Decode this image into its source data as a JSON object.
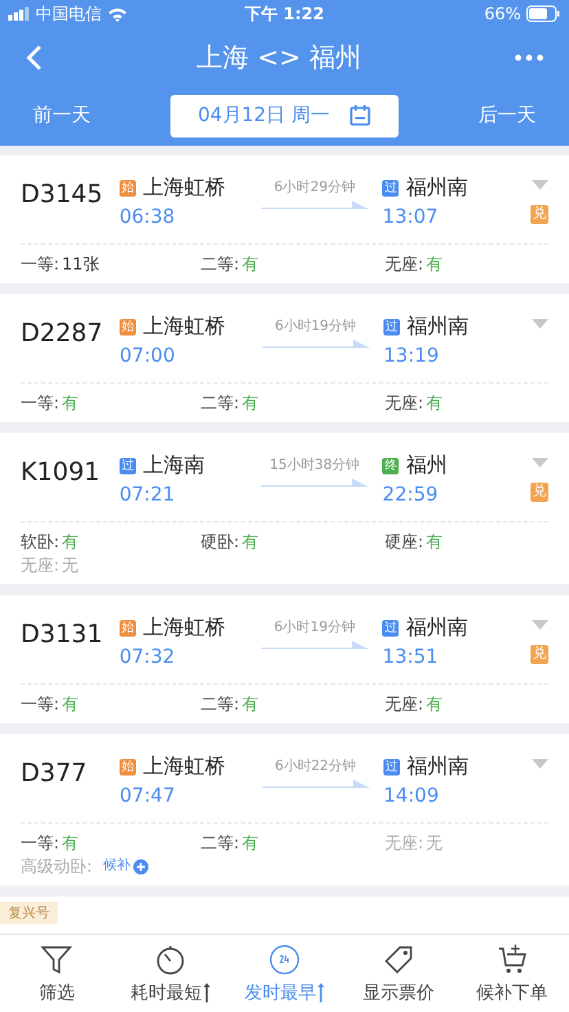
{
  "status_bar": {
    "carrier": "中国电信",
    "time": "下午 1:22",
    "battery": "66%"
  },
  "nav": {
    "title": "上海 <> 福州"
  },
  "date_bar": {
    "prev": "前一天",
    "date": "04月12日 周一",
    "next": "后一天"
  },
  "trains": [
    {
      "number": "D3145",
      "from": {
        "badge": "始",
        "kind": "origin",
        "station": "上海虹桥",
        "time": "06:38"
      },
      "duration": "6小时29分钟",
      "to": {
        "badge": "过",
        "kind": "pass",
        "station": "福州南",
        "time": "13:07"
      },
      "exchange": "兑",
      "seats": [
        {
          "label": "一等:",
          "value": "11张",
          "kind": "count"
        },
        {
          "label": "二等:",
          "value": "有",
          "kind": "available"
        },
        {
          "label": "无座:",
          "value": "有",
          "kind": "available"
        }
      ]
    },
    {
      "number": "D2287",
      "from": {
        "badge": "始",
        "kind": "origin",
        "station": "上海虹桥",
        "time": "07:00"
      },
      "duration": "6小时19分钟",
      "to": {
        "badge": "过",
        "kind": "pass",
        "station": "福州南",
        "time": "13:19"
      },
      "seats": [
        {
          "label": "一等:",
          "value": "有",
          "kind": "available"
        },
        {
          "label": "二等:",
          "value": "有",
          "kind": "available"
        },
        {
          "label": "无座:",
          "value": "有",
          "kind": "available"
        }
      ]
    },
    {
      "number": "K1091",
      "from": {
        "badge": "过",
        "kind": "pass",
        "station": "上海南",
        "time": "07:21"
      },
      "duration": "15小时38分钟",
      "to": {
        "badge": "终",
        "kind": "terminal",
        "station": "福州",
        "time": "22:59"
      },
      "exchange": "兑",
      "seats": [
        {
          "label": "软卧:",
          "value": "有",
          "kind": "available"
        },
        {
          "label": "硬卧:",
          "value": "有",
          "kind": "available"
        },
        {
          "label": "硬座:",
          "value": "有",
          "kind": "available"
        },
        {
          "label": "无座:",
          "value": "无",
          "kind": "none"
        }
      ]
    },
    {
      "number": "D3131",
      "from": {
        "badge": "始",
        "kind": "origin",
        "station": "上海虹桥",
        "time": "07:32"
      },
      "duration": "6小时19分钟",
      "to": {
        "badge": "过",
        "kind": "pass",
        "station": "福州南",
        "time": "13:51"
      },
      "exchange": "兑",
      "seats": [
        {
          "label": "一等:",
          "value": "有",
          "kind": "available"
        },
        {
          "label": "二等:",
          "value": "有",
          "kind": "available"
        },
        {
          "label": "无座:",
          "value": "有",
          "kind": "available"
        }
      ]
    },
    {
      "number": "D377",
      "from": {
        "badge": "始",
        "kind": "origin",
        "station": "上海虹桥",
        "time": "07:47"
      },
      "duration": "6小时22分钟",
      "to": {
        "badge": "过",
        "kind": "pass",
        "station": "福州南",
        "time": "14:09"
      },
      "seats": [
        {
          "label": "一等:",
          "value": "有",
          "kind": "available"
        },
        {
          "label": "二等:",
          "value": "有",
          "kind": "available"
        },
        {
          "label": "无座:",
          "value": "无",
          "kind": "none"
        },
        {
          "label": "高级动卧:",
          "value": "候补",
          "kind": "waitlist"
        }
      ]
    }
  ],
  "partial_card": {
    "tag": "复兴号"
  },
  "tab_bar": [
    {
      "label": "筛选",
      "kind": "filter",
      "sort": false,
      "selected": false
    },
    {
      "label": "耗时最短",
      "kind": "timer",
      "sort": true,
      "selected": false
    },
    {
      "label": "发时最早",
      "kind": "clock24",
      "sort": true,
      "selected": true
    },
    {
      "label": "显示票价",
      "kind": "tag",
      "sort": false,
      "selected": false
    },
    {
      "label": "候补下单",
      "kind": "cart",
      "sort": false,
      "selected": false
    }
  ]
}
